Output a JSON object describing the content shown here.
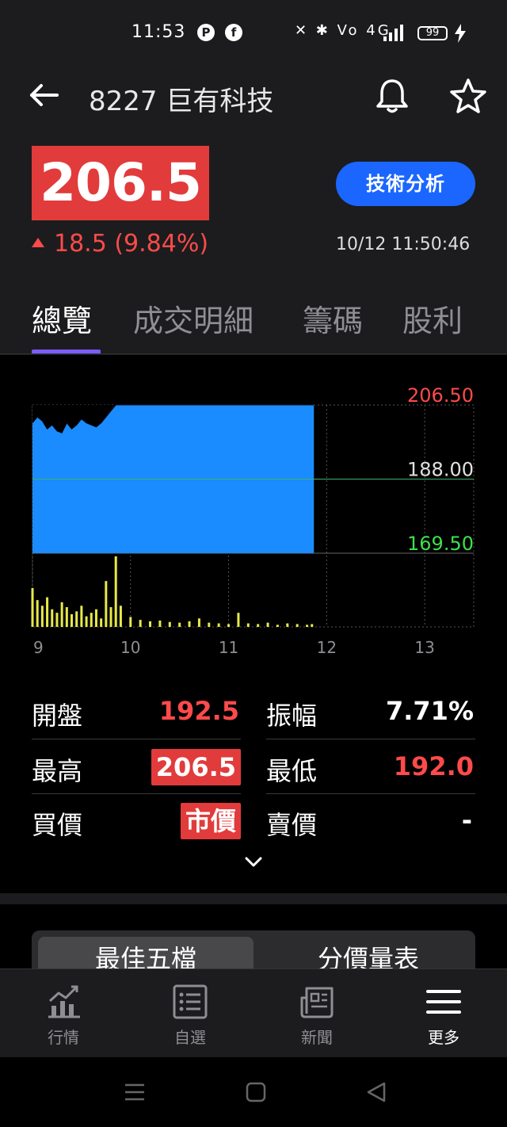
{
  "status_bar": {
    "time": "11:53",
    "icons_left": [
      "p-icon",
      "facebook-icon"
    ],
    "right_text": "✕ ✱ Vo 4G",
    "battery": "99"
  },
  "header": {
    "title": "8227 巨有科技",
    "price": "206.5",
    "change": "18.5 (9.84%)",
    "timestamp": "10/12 11:50:46",
    "ta_button": "技術分析"
  },
  "tabs": [
    {
      "label": "總覽",
      "active": true
    },
    {
      "label": "成交明細",
      "active": false
    },
    {
      "label": "籌碼",
      "active": false
    },
    {
      "label": "股利",
      "active": false
    }
  ],
  "chart_data": {
    "type": "area",
    "price_labels": {
      "high": "206.50",
      "ref": "188.00",
      "low": "169.50"
    },
    "ylim": [
      169.5,
      206.5
    ],
    "reference": 188.0,
    "x_ticks": [
      "9",
      "10",
      "11",
      "12",
      "13"
    ],
    "xlim": [
      9,
      13.5
    ],
    "price_series": {
      "x": [
        9.0,
        9.05,
        9.1,
        9.15,
        9.2,
        9.25,
        9.3,
        9.35,
        9.4,
        9.45,
        9.5,
        9.55,
        9.6,
        9.65,
        9.7,
        9.75,
        9.8,
        9.85,
        11.87
      ],
      "y": [
        202.0,
        203.5,
        202.5,
        200.5,
        201.5,
        200.0,
        199.5,
        202.0,
        200.5,
        201.5,
        203.0,
        202.0,
        201.5,
        201.0,
        202.0,
        203.5,
        205.0,
        206.5,
        206.5
      ]
    },
    "volume_series": {
      "x": [
        9.0,
        9.05,
        9.1,
        9.15,
        9.2,
        9.25,
        9.3,
        9.35,
        9.4,
        9.45,
        9.5,
        9.55,
        9.6,
        9.65,
        9.7,
        9.75,
        9.8,
        9.85,
        9.9,
        10.0,
        10.1,
        10.2,
        10.3,
        10.4,
        10.5,
        10.6,
        10.7,
        10.8,
        10.9,
        11.0,
        11.1,
        11.2,
        11.3,
        11.4,
        11.5,
        11.6,
        11.7,
        11.8,
        11.85
      ],
      "v": [
        55,
        38,
        30,
        42,
        25,
        20,
        35,
        28,
        18,
        22,
        30,
        15,
        20,
        25,
        12,
        65,
        28,
        100,
        30,
        14,
        10,
        8,
        9,
        7,
        6,
        8,
        12,
        6,
        5,
        4,
        20,
        5,
        4,
        6,
        3,
        5,
        4,
        3,
        4
      ]
    }
  },
  "stats": {
    "open_label": "開盤",
    "open_value": "192.5",
    "amp_label": "振幅",
    "amp_value": "7.71%",
    "high_label": "最高",
    "high_value": "206.5",
    "low_label": "最低",
    "low_value": "192.0",
    "bid_label": "買價",
    "bid_value": "市價",
    "ask_label": "賣價",
    "ask_value": "-"
  },
  "order_book_tabs": {
    "best": "最佳五檔",
    "volume": "分價量表"
  },
  "bottom_nav": [
    {
      "label": "行情",
      "icon": "market-chart-icon",
      "active": false
    },
    {
      "label": "自選",
      "icon": "watchlist-icon",
      "active": false
    },
    {
      "label": "新聞",
      "icon": "news-icon",
      "active": false
    },
    {
      "label": "更多",
      "icon": "menu-icon",
      "active": true
    }
  ],
  "colors": {
    "up": "#ff4a4a",
    "down": "#3ee04a",
    "area": "#1a8cff",
    "volume": "#e8e84a",
    "accent": "#1a66ff"
  }
}
